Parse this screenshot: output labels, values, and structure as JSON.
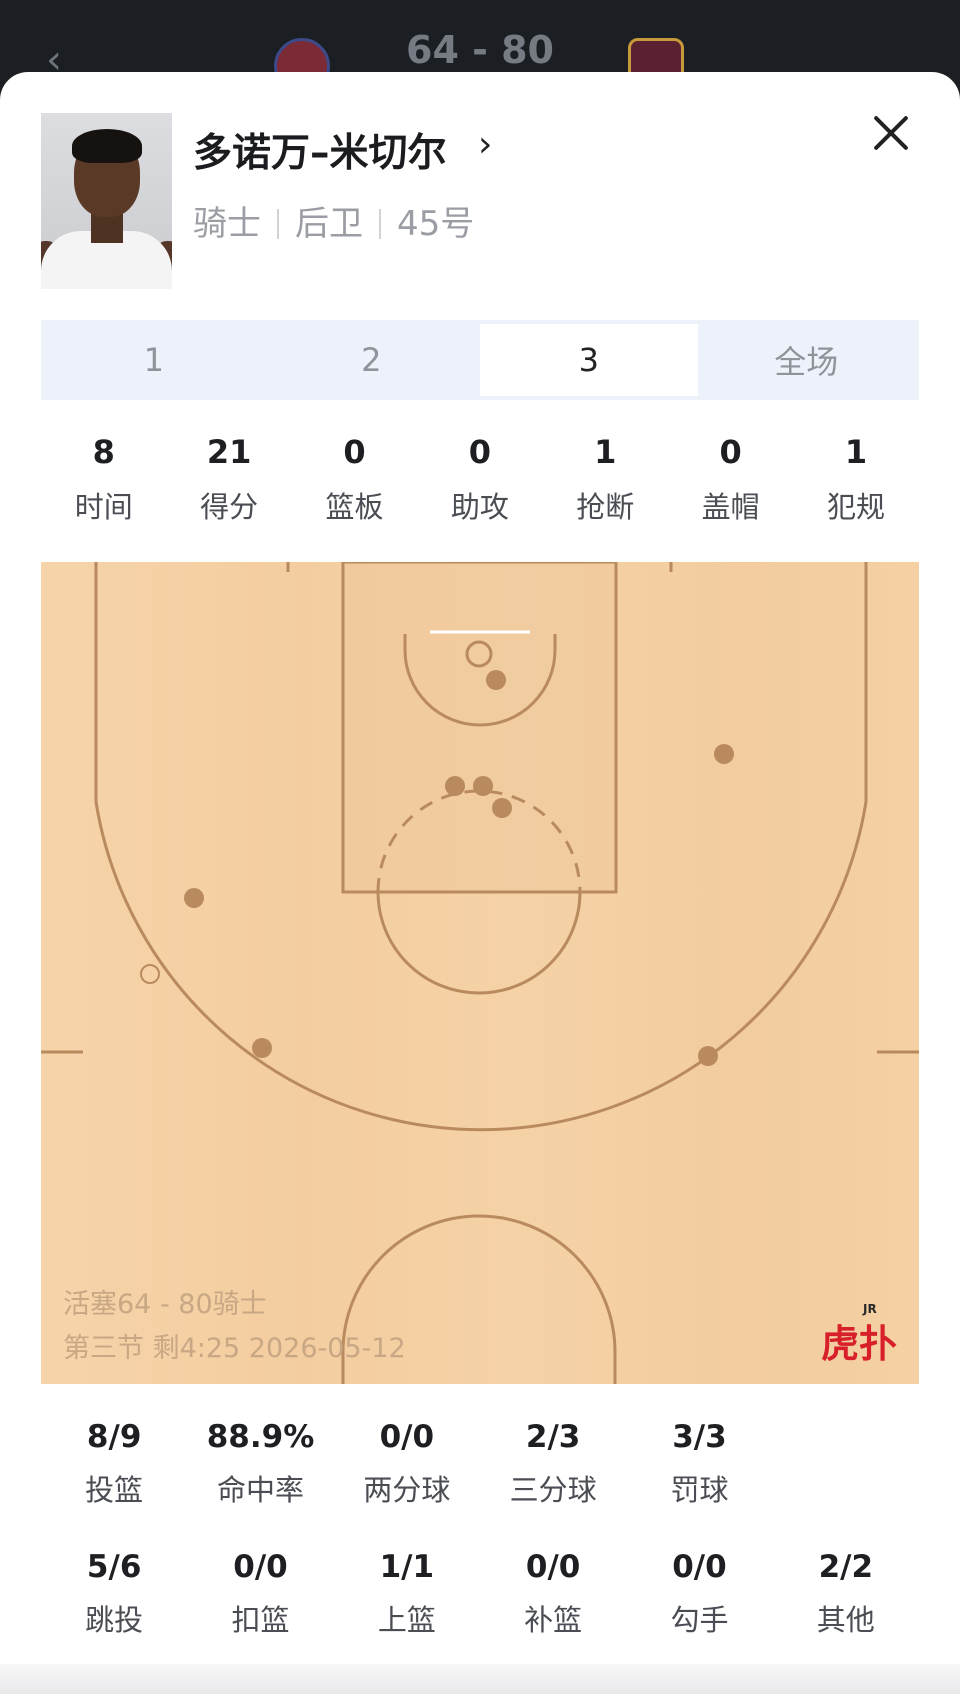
{
  "header": {
    "score": "64 - 80",
    "back_icon": "chevron-left-icon",
    "home_team_logo": "pistons-logo",
    "away_team_logo": "cavaliers-logo"
  },
  "player": {
    "name": "多诺万–米切尔",
    "team": "骑士",
    "position": "后卫",
    "number": "45号",
    "avatar": "player-photo"
  },
  "tabs": [
    {
      "label": "1",
      "active": false
    },
    {
      "label": "2",
      "active": false
    },
    {
      "label": "3",
      "active": true
    },
    {
      "label": "全场",
      "active": false
    }
  ],
  "summary_stats": [
    {
      "value": "8",
      "label": "时间"
    },
    {
      "value": "21",
      "label": "得分"
    },
    {
      "value": "0",
      "label": "篮板"
    },
    {
      "value": "0",
      "label": "助攻"
    },
    {
      "value": "1",
      "label": "抢断"
    },
    {
      "value": "0",
      "label": "盖帽"
    },
    {
      "value": "1",
      "label": "犯规"
    }
  ],
  "shot_chart": {
    "caption_line1": "活塞64 - 80骑士",
    "caption_line2": "第三节 剩4:25 2026-05-12",
    "brand": "虎扑",
    "brand_superscript": "JR",
    "court_color": "#f4cfa2",
    "line_color": "#b98a5e",
    "made_color": "#b98a5e",
    "missed_style": "hollow"
  },
  "shooting": {
    "row1": [
      {
        "value": "8/9",
        "label": "投篮"
      },
      {
        "value": "88.9%",
        "label": "命中率"
      },
      {
        "value": "0/0",
        "label": "两分球"
      },
      {
        "value": "2/3",
        "label": "三分球"
      },
      {
        "value": "3/3",
        "label": "罚球"
      }
    ],
    "row2": [
      {
        "value": "5/6",
        "label": "跳投"
      },
      {
        "value": "0/0",
        "label": "扣篮"
      },
      {
        "value": "1/1",
        "label": "上篮"
      },
      {
        "value": "0/0",
        "label": "补篮"
      },
      {
        "value": "0/0",
        "label": "勾手"
      },
      {
        "value": "2/2",
        "label": "其他"
      }
    ]
  }
}
